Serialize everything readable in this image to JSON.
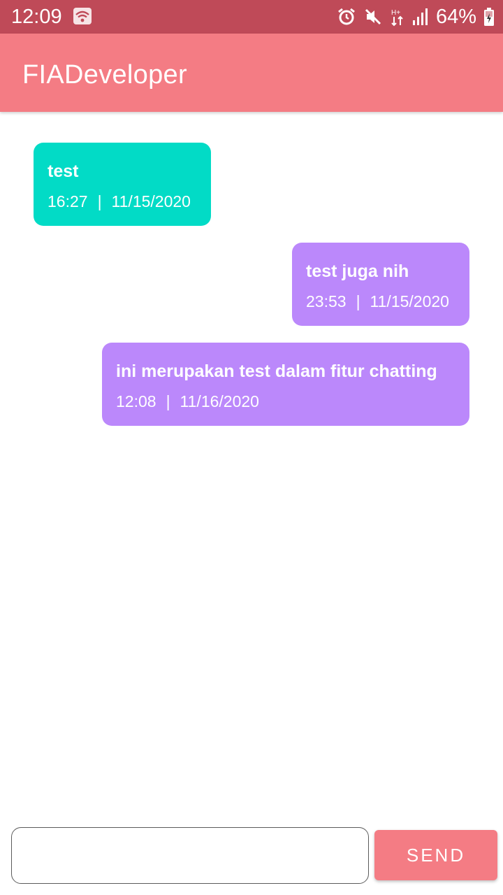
{
  "status_bar": {
    "time": "12:09",
    "battery_percent": "64%",
    "icons": [
      "wifi-icon",
      "alarm-icon",
      "mute-icon",
      "data-transfer-icon",
      "signal-icon",
      "battery-icon"
    ]
  },
  "app_bar": {
    "title": "FIADeveloper",
    "color": "#f47c84"
  },
  "messages": [
    {
      "direction": "incoming",
      "text": "test",
      "time": "16:27",
      "separator": "|",
      "date": "11/15/2020",
      "color": "#02dbc6"
    },
    {
      "direction": "outgoing",
      "text": "test juga nih",
      "time": "23:53",
      "separator": "|",
      "date": "11/15/2020",
      "color": "#bb88fb"
    },
    {
      "direction": "outgoing",
      "text": "ini merupakan test dalam fitur chatting",
      "time": "12:08",
      "separator": "|",
      "date": "11/16/2020",
      "color": "#bb88fb"
    }
  ],
  "composer": {
    "input_value": "",
    "placeholder": "",
    "send_label": "SEND"
  }
}
